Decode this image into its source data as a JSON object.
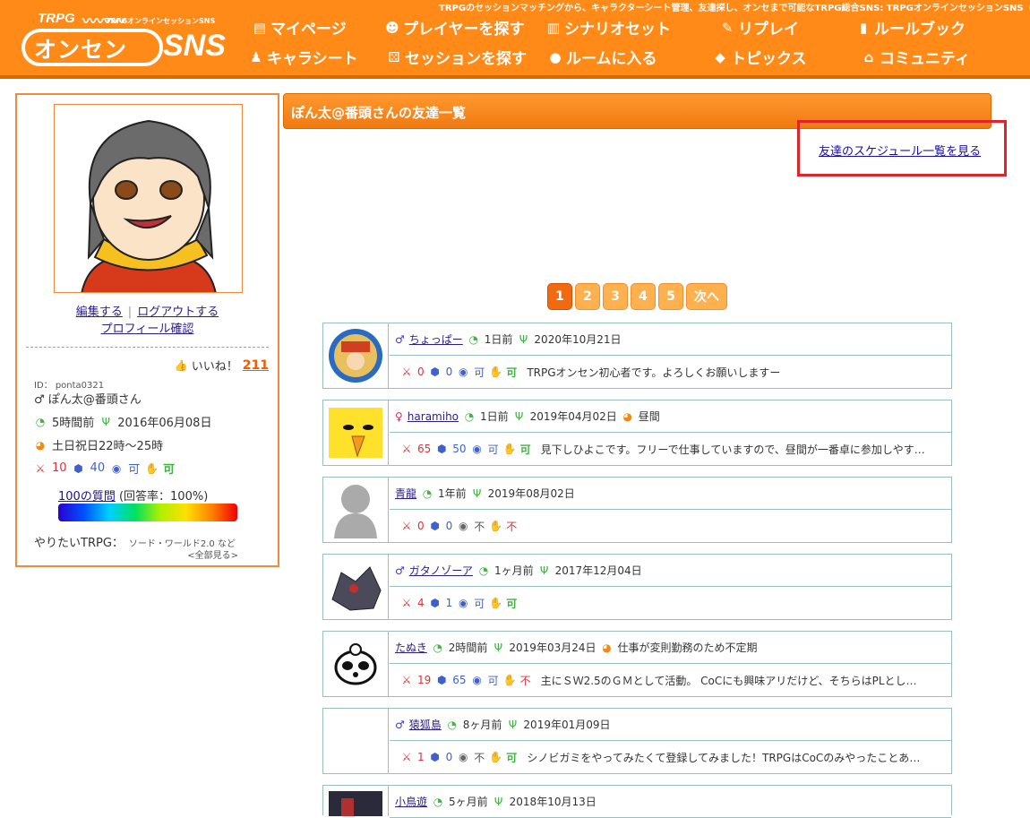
{
  "header": {
    "tagline": "TRPGのセッションマッチングから、キャラクターシート管理、友達探し、オンセまで可能なTRPG総合SNS: TRPGオンラインセッションSNS（略",
    "logo_top": "TRPG",
    "logo_sub": "TRPGオンラインセッションSNS",
    "logo_main": "オンセン",
    "logo_sns": "SNS",
    "nav": [
      {
        "label": "マイページ",
        "icon": "mypage-icon"
      },
      {
        "label": "プレイヤーを探す",
        "icon": "player-search-icon"
      },
      {
        "label": "シナリオセット",
        "icon": "scenario-icon"
      },
      {
        "label": "リプレイ",
        "icon": "replay-icon"
      },
      {
        "label": "ルールブック",
        "icon": "rulebook-icon"
      },
      {
        "label": "キャラシート",
        "icon": "charasheet-icon"
      },
      {
        "label": "セッションを探す",
        "icon": "dice-icon"
      },
      {
        "label": "ルームに入る",
        "icon": "room-icon"
      },
      {
        "label": "トピックス",
        "icon": "tag-icon"
      },
      {
        "label": "コミュニティ",
        "icon": "community-icon"
      }
    ]
  },
  "sidebar": {
    "edit": "編集する",
    "separator": "|",
    "logout": "ログアウトする",
    "profile": "プロフィール確認",
    "like_label": "いいね！",
    "like_count": "211",
    "id_line": "ID： ponta0321",
    "name": "♂ ぽん太@番頭さん",
    "last_login": "5時間前",
    "registered": "2016年06月08日",
    "schedule": "土日祝日22時～25時",
    "gm_count": "10",
    "pl_count": "40",
    "voice": "可",
    "text": "可",
    "questions_link": "100の質問",
    "answer_rate": "(回答率：100%)",
    "want_label": "やりたいTRPG：",
    "want_value": "ソード・ワールド2.0 など",
    "see_all": "<全部見る>"
  },
  "main": {
    "title": "ぽん太@番頭さんの友達一覧",
    "schedule_link": "友達のスケジュール一覧を見る",
    "pages": [
      "1",
      "2",
      "3",
      "4",
      "5"
    ],
    "next": "次へ",
    "friends": [
      {
        "sex": "♂",
        "name": "ちょっぱー",
        "login": "1日前",
        "date": "2020年10月21日",
        "time": "",
        "gm": "0",
        "pl": "0",
        "voice": "可",
        "text": "可",
        "intro": "TRPGオンセン初心者です。よろしくお願いしますー"
      },
      {
        "sex": "♀",
        "name": "haramiho",
        "login": "1日前",
        "date": "2019年04月02日",
        "time": "昼間",
        "gm": "65",
        "pl": "50",
        "voice": "可",
        "text": "可",
        "intro": "見下しひよこです。フリーで仕事していますので、昼間が一番卓に参加しやす…"
      },
      {
        "sex": "",
        "name": "青龍",
        "login": "1年前",
        "date": "2019年08月02日",
        "time": "",
        "gm": "0",
        "pl": "0",
        "voice": "不",
        "text": "不",
        "intro": ""
      },
      {
        "sex": "♂",
        "name": "ガタノゾーア",
        "login": "1ヶ月前",
        "date": "2017年12月04日",
        "time": "",
        "gm": "4",
        "pl": "1",
        "voice": "可",
        "text": "可",
        "intro": ""
      },
      {
        "sex": "",
        "name": "たぬき",
        "login": "2時間前",
        "date": "2019年03月24日",
        "time": "仕事が変則勤務のため不定期",
        "gm": "19",
        "pl": "65",
        "voice": "可",
        "text": "不",
        "intro": "主にＳＷ2.5のＧＭとして活動。 CoCにも興味アリだけど、そちらはPLとし…"
      },
      {
        "sex": "♂",
        "name": "猿狐島",
        "login": "8ヶ月前",
        "date": "2019年01月09日",
        "time": "",
        "gm": "1",
        "pl": "0",
        "voice": "不",
        "text": "可",
        "intro": "シノビガミをやってみたくて登録してみました！TRPGはCoCのみやったことあり…"
      },
      {
        "sex": "",
        "name": "小鳥遊",
        "login": "5ヶ月前",
        "date": "2018年10月13日",
        "time": "",
        "gm": "",
        "pl": "",
        "voice": "",
        "text": "",
        "intro": ""
      }
    ]
  },
  "colors": {
    "header": "#ff8a17",
    "accent": "#f08a3c",
    "highlight": "#e0242a"
  }
}
